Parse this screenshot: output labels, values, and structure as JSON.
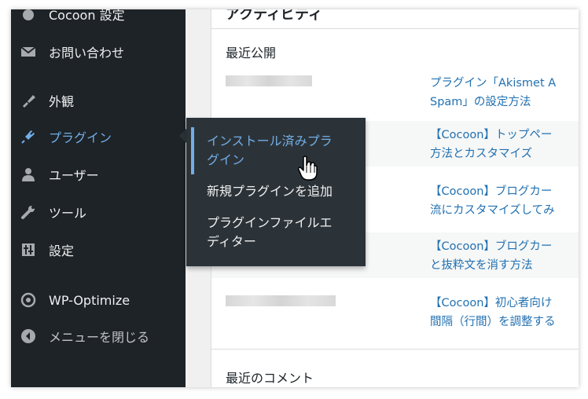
{
  "sidebar": {
    "items": [
      {
        "label": "Cocoon 設定",
        "icon": "cocoon-icon"
      },
      {
        "label": "お問い合わせ",
        "icon": "mail-icon"
      },
      {
        "label": "外観",
        "icon": "paintbrush-icon"
      },
      {
        "label": "プラグイン",
        "icon": "plugin-icon",
        "active": true
      },
      {
        "label": "ユーザー",
        "icon": "user-icon"
      },
      {
        "label": "ツール",
        "icon": "wrench-icon"
      },
      {
        "label": "設定",
        "icon": "settings-icon"
      },
      {
        "label": "WP-Optimize",
        "icon": "wp-optimize-icon"
      },
      {
        "label": "メニューを閉じる",
        "icon": "collapse-icon"
      }
    ]
  },
  "flyout": {
    "items": [
      {
        "label_line1": "インストール済みプラ",
        "label_line2": "グイン",
        "current": true
      },
      {
        "label_line1": "新規プラグインを追加"
      },
      {
        "label_line1": "プラグインファイルエ",
        "label_line2": "ディター"
      }
    ]
  },
  "panel": {
    "title": "アクティビティ",
    "recent_published": "最近公開",
    "posts": [
      {
        "line1": "プラグイン「Akismet A",
        "line2": "Spam」の設定方法"
      },
      {
        "line1": "【Cocoon】トップペー",
        "line2": "方法とカスタマイズ"
      },
      {
        "line1": "【Cocoon】ブログカー",
        "line2": "流にカスタマイズしてみ"
      },
      {
        "line1": "【Cocoon】ブログカー",
        "line2": "と抜粋文を消す方法"
      },
      {
        "line1": "【Cocoon】初心者向け",
        "line2": "間隔（行間）を調整する"
      }
    ],
    "recent_comments": "最近のコメント"
  },
  "colors": {
    "sidebar_bg": "#1d2327",
    "flyout_bg": "#2c3338",
    "accent": "#72aee6",
    "link": "#2271b1"
  }
}
